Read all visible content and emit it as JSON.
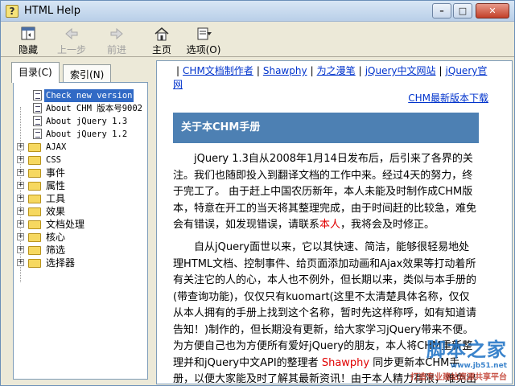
{
  "window": {
    "title": "HTML Help",
    "app_icon": "?"
  },
  "controls": {
    "minimize": "–",
    "maximize": "□",
    "close": "✕"
  },
  "toolbar": {
    "hide": "隐藏",
    "back": "上一步",
    "forward": "前进",
    "home": "主页",
    "options": "选项(O)"
  },
  "tabs": {
    "contents": "目录(C)",
    "index": "索引(N)"
  },
  "tree": {
    "items": [
      {
        "label": "Check new version",
        "type": "page"
      },
      {
        "label": "About CHM 版本号9002",
        "type": "page"
      },
      {
        "label": "About jQuery 1.3",
        "type": "page"
      },
      {
        "label": "About jQuery 1.2",
        "type": "page"
      },
      {
        "label": "AJAX",
        "type": "folder"
      },
      {
        "label": "CSS",
        "type": "folder"
      },
      {
        "label": "事件",
        "type": "folder"
      },
      {
        "label": "属性",
        "type": "folder"
      },
      {
        "label": "工具",
        "type": "folder"
      },
      {
        "label": "效果",
        "type": "folder"
      },
      {
        "label": "文档处理",
        "type": "folder"
      },
      {
        "label": "核心",
        "type": "folder"
      },
      {
        "label": "筛选",
        "type": "folder"
      },
      {
        "label": "选择器",
        "type": "folder"
      }
    ]
  },
  "content": {
    "links": {
      "chm_author": "CHM文档制作者",
      "shawphy": "Shawphy",
      "manga": "为之漫笔",
      "jquery_cn": "jQuery中文网站",
      "jquery_official": "jQuery官网",
      "chm_download": "CHM最新版本下载"
    },
    "heading": "关于本CHM手册",
    "para1_a": "jQuery 1.3自从2008年1月14日发布后，后引来了各界的关注。我们也随即投入到翻译文档的工作中来。经过4天的努力，终于完工了。 由于赶上中国农历新年，本人未能及时制作成CHM版本，特意在开工的当天将其整理完成，由于时间赶的比较急，难免会有错误，如发现错误，请联系",
    "para1_link": "本人",
    "para1_b": "，我将会及时修正。",
    "para2_a": "自从jQuery面世以来，它以其快速、简洁，能够很轻易地处理HTML文档、控制事件、给页面添加动画和Ajax效果等打动着所有关注它的人的心，本人也不例外，但长期以来，类似与本手册的(带查询功能)，仅仅只有kuomart(这里不太清楚具体名称，仅仅从本人拥有的手册上找到这个名称，暂时先这样称呼，如有知道请告知！)制作的，但长期没有更新，给大家学习jQuery带来不便。为方便自己也为方便所有爱好jQuery的朋友，本人将CHM重新整理并和jQuery中文API的整理者 ",
    "para2_link": "Shawphy",
    "para2_b": " 同步更新本CHM手册，以便大家能及时了解其最新资讯！由于本人精力有限，难免出现差错"
  },
  "watermark": {
    "brand": "脚本之家",
    "url": "www.jb51.net",
    "slogan": "打造专业建站资源共享平台"
  },
  "colors": {
    "heading_bg": "#4d80b3",
    "link": "#0033cc",
    "highlight_red": "#e00000",
    "selection": "#316ac5"
  }
}
